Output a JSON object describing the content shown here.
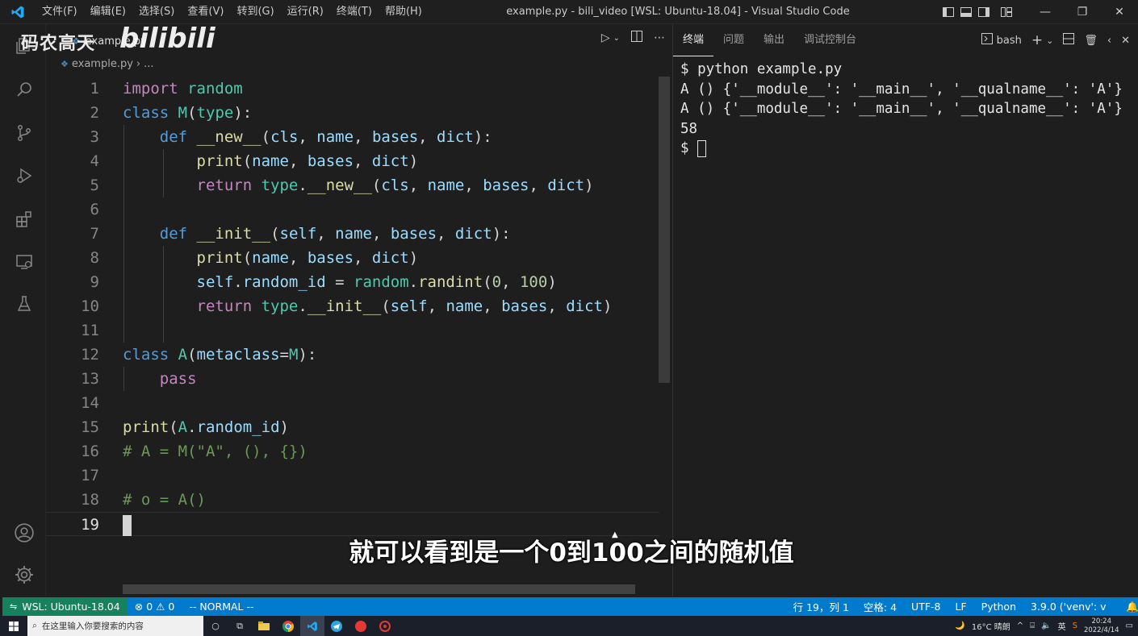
{
  "titlebar": {
    "menus": [
      "文件(F)",
      "编辑(E)",
      "选择(S)",
      "查看(V)",
      "转到(G)",
      "运行(R)",
      "终端(T)",
      "帮助(H)"
    ],
    "window_title": "example.py - bili_video [WSL: Ubuntu-18.04] - Visual Studio Code"
  },
  "watermark": {
    "channel": "码农高天",
    "logo": "bilibili"
  },
  "editor": {
    "tab_label": "example.py",
    "breadcrumb_file": "example.py",
    "breadcrumb_more": "...",
    "line_numbers": [
      "1",
      "2",
      "3",
      "4",
      "5",
      "6",
      "7",
      "8",
      "9",
      "10",
      "11",
      "12",
      "13",
      "14",
      "15",
      "16",
      "17",
      "18",
      "19"
    ]
  },
  "terminal": {
    "tabs": [
      "终端",
      "问题",
      "输出",
      "调试控制台"
    ],
    "shell": "bash",
    "lines": [
      "$ python example.py",
      "A () {'__module__': '__main__', '__qualname__': 'A'}",
      "A () {'__module__': '__main__', '__qualname__': 'A'}",
      "58"
    ],
    "prompt": "$ "
  },
  "statusbar": {
    "remote": "WSL: Ubuntu-18.04",
    "errors": "0",
    "warnings": "0",
    "mode": "-- NORMAL --",
    "position": "行 19，列 1",
    "spaces": "空格: 4",
    "encoding": "UTF-8",
    "eol": "LF",
    "language": "Python",
    "interpreter": "3.9.0 ('venv': v"
  },
  "taskbar": {
    "search_placeholder": "在这里输入你要搜索的内容",
    "weather": "16°C 晴朗",
    "ime": "英",
    "time": "20:24",
    "date": "2022/4/14"
  },
  "subtitle": "就可以看到是一个0到100之间的随机值",
  "colors": {
    "statusbar": "#007acc",
    "remote": "#16825d",
    "editor_bg": "#1e1e1e"
  }
}
